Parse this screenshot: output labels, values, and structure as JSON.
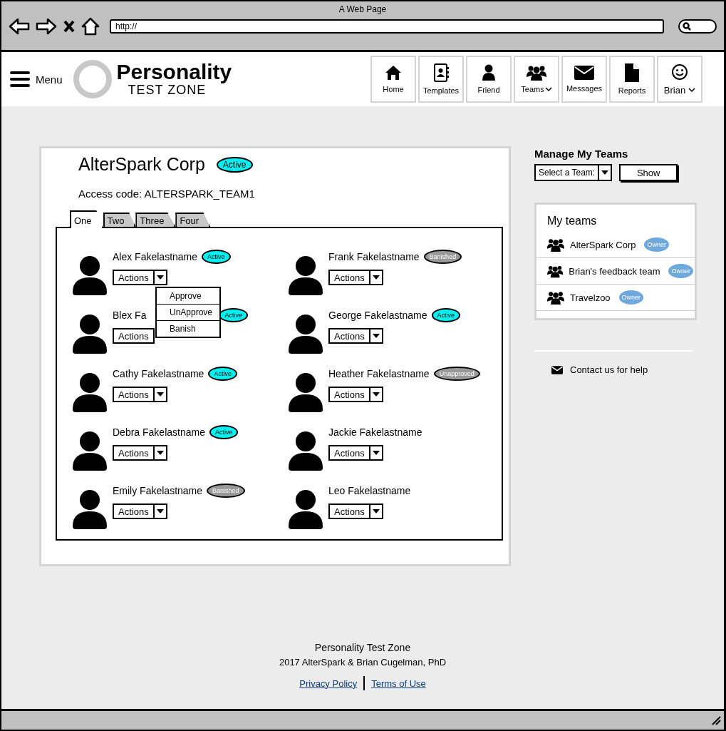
{
  "browser": {
    "title": "A Web Page",
    "url": "http://"
  },
  "header": {
    "menu_label": "Menu",
    "logo_title": "Personality",
    "logo_subtitle": "TEST ZONE",
    "nav": [
      {
        "kind": "home",
        "label": "Home",
        "caret": false
      },
      {
        "kind": "templates",
        "label": "Templates",
        "caret": false
      },
      {
        "kind": "friend",
        "label": "Friend",
        "caret": false
      },
      {
        "kind": "teams",
        "label": "Teams",
        "caret": true
      },
      {
        "kind": "messages",
        "label": "Messages",
        "caret": false
      },
      {
        "kind": "reports",
        "label": "Reports",
        "caret": false
      },
      {
        "kind": "user",
        "label": "Brian",
        "caret": true
      }
    ]
  },
  "team": {
    "name": "AlterSpark Corp",
    "status": {
      "kind": "active",
      "label": "Active"
    },
    "access_code": "Access code: ALTERSPARK_TEAM1",
    "tabs": [
      {
        "label": "One",
        "selected": true
      },
      {
        "label": "Two",
        "selected": false
      },
      {
        "label": "Three",
        "selected": false
      },
      {
        "label": "Four",
        "selected": false
      }
    ],
    "members": [
      {
        "name": "Alex Fakelastname",
        "badge": {
          "kind": "active",
          "label": "Active"
        },
        "actions": "Actions",
        "caret": true,
        "open_menu": [
          "Approve",
          "UnApprove",
          "Banish"
        ]
      },
      {
        "name": "Frank Fakelastname",
        "badge": {
          "kind": "banished",
          "label": "Banished"
        },
        "actions": "Actions",
        "caret": true
      },
      {
        "name": "Blex Fa",
        "badge": {
          "kind": "active",
          "label": "Active"
        },
        "actions": "Actions",
        "caret": false
      },
      {
        "name": "George Fakelastname",
        "badge": {
          "kind": "active",
          "label": "Active"
        },
        "actions": "Actions",
        "caret": true
      },
      {
        "name": "Cathy Fakelastname",
        "badge": {
          "kind": "active",
          "label": "Active"
        },
        "actions": "Actions",
        "caret": true
      },
      {
        "name": "Heather Fakelastname",
        "badge": {
          "kind": "unapproved",
          "label": "Unapproved"
        },
        "actions": "Actions",
        "caret": true
      },
      {
        "name": "Debra Fakelastname",
        "badge": {
          "kind": "active",
          "label": "Active"
        },
        "actions": "Actions",
        "caret": true
      },
      {
        "name": "Jackie Fakelastname",
        "actions": "Actions",
        "caret": true
      },
      {
        "name": "Emily Fakelastname",
        "badge": {
          "kind": "banished",
          "label": "Banished"
        },
        "actions": "Actions",
        "caret": true
      },
      {
        "name": "Leo Fakelastname",
        "actions": "Actions",
        "caret": true
      }
    ]
  },
  "sidebar": {
    "title": "Manage My Teams",
    "select_placeholder": "Select a Team:",
    "show_button": "Show",
    "my_teams_title": "My teams",
    "teams": [
      {
        "name": "AlterSpark Corp",
        "role": "Owner"
      },
      {
        "name": "Brian's feedback team",
        "role": "Owner"
      },
      {
        "name": "Travelzoo",
        "role": "Owner"
      }
    ],
    "contact": "Contact us for help"
  },
  "footer": {
    "title": "Personality Test Zone",
    "copyright": "2017 AlterSpark & Brian Cugelman, PhD",
    "links": [
      "Privacy Policy",
      "Terms of Use"
    ]
  }
}
